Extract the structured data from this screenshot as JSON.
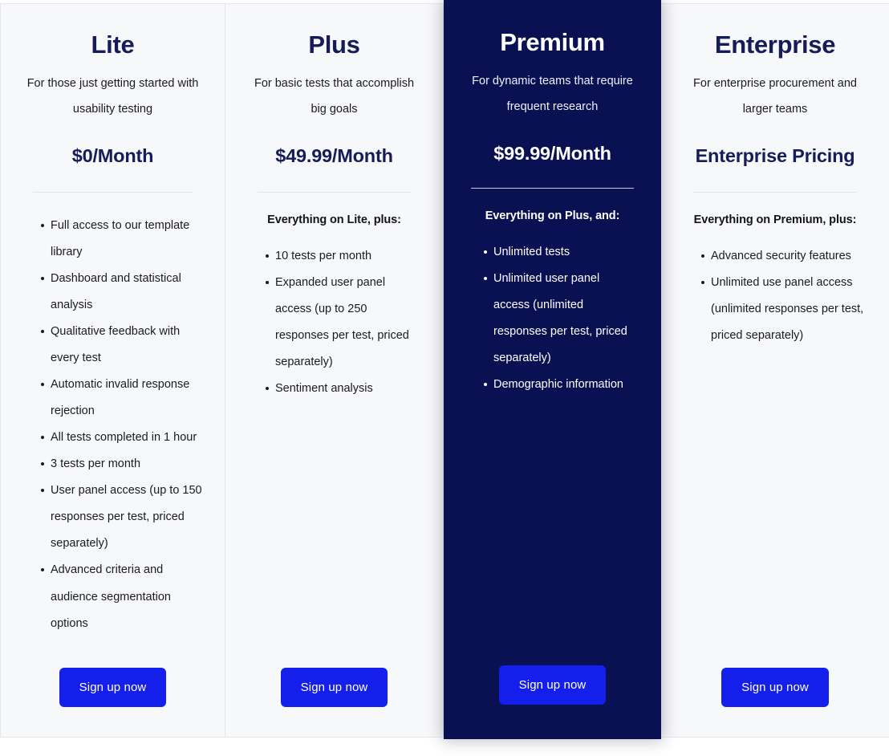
{
  "theme": {
    "card_bg": "#f7f8fa",
    "featured_bg": "#0a1152",
    "heading_navy": "#151c58",
    "cta_blue": "#141fec",
    "body_text": "#1b1b1f",
    "divider": "#e2e3e9"
  },
  "cta_label": "Sign up now",
  "plans": [
    {
      "id": "lite",
      "name": "Lite",
      "tagline": "For those just getting started with usability testing",
      "price": "$0/Month",
      "includes": "",
      "features": [
        "Full access to our template library",
        "Dashboard and statistical analysis",
        "Qualitative feedback with every test",
        "Automatic invalid response rejection",
        "All tests completed in 1 hour",
        "3 tests per month",
        "User panel access (up to  150 responses per test, priced separately)",
        "Advanced criteria and audience segmentation options"
      ],
      "cta": "Sign up now",
      "featured": false
    },
    {
      "id": "plus",
      "name": "Plus",
      "tagline": "For basic tests that accomplish big goals",
      "price": "$49.99/Month",
      "includes": "Everything on Lite, plus:",
      "features": [
        "10 tests per month",
        "Expanded user panel access (up to 250 responses per test, priced separately)",
        "Sentiment analysis"
      ],
      "cta": "Sign up now",
      "featured": false
    },
    {
      "id": "premium",
      "name": "Premium",
      "tagline": "For dynamic teams that require frequent research",
      "price": "$99.99/Month",
      "includes": "Everything on Plus, and:",
      "features": [
        "Unlimited tests",
        "Unlimited user panel access (unlimited responses per test, priced separately)",
        "Demographic information"
      ],
      "cta": "Sign up now",
      "featured": true
    },
    {
      "id": "enterprise",
      "name": "Enterprise",
      "tagline": "For enterprise procurement and larger teams",
      "price": "Enterprise Pricing",
      "includes": "Everything on Premium, plus:",
      "features": [
        "Advanced security features",
        "Unlimited use panel access (unlimited responses per test, priced separately)"
      ],
      "cta": "Sign up now",
      "featured": false
    }
  ]
}
